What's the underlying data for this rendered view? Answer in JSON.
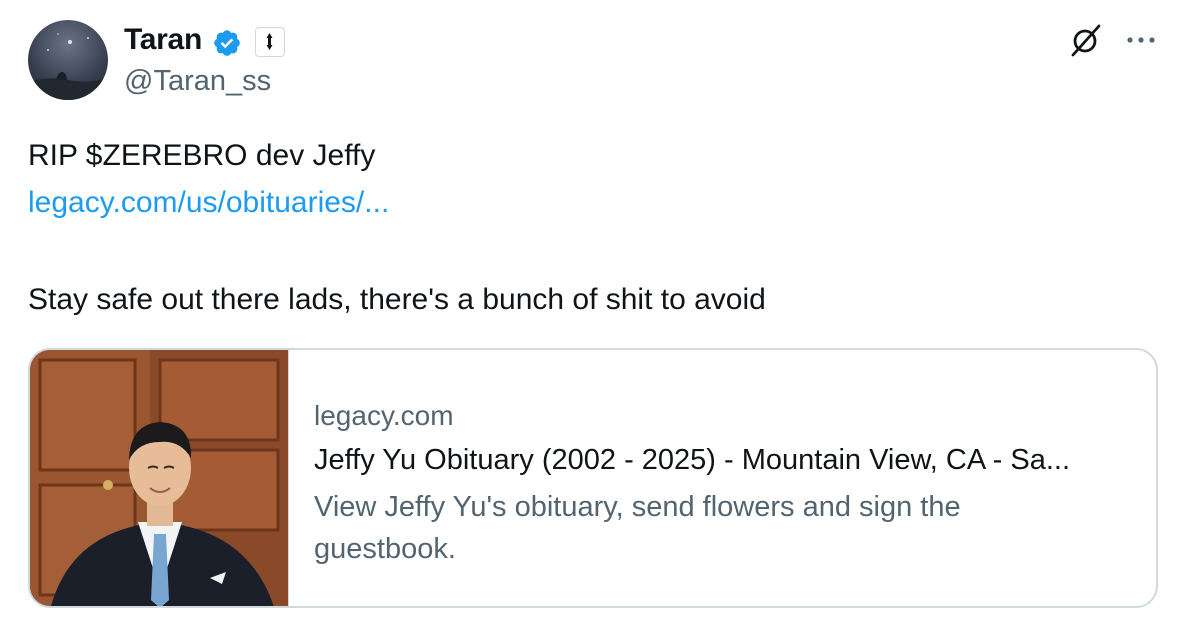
{
  "author": {
    "display_name": "Taran",
    "handle": "@Taran_ss",
    "verified": true,
    "avatar_icon": "avatar-night-sky",
    "affiliate_badge_icon": "affiliate-badge-icon"
  },
  "header_actions": {
    "grok_icon": "grok-icon",
    "more_icon": "more-icon"
  },
  "tweet": {
    "line1": "RIP $ZEREBRO dev Jeffy",
    "link_text": "legacy.com/us/obituaries/...",
    "line3": "Stay safe out there lads, there's a bunch of shit to avoid"
  },
  "link_card": {
    "domain": "legacy.com",
    "title": "Jeffy Yu Obituary (2002 - 2025) - Mountain View, CA - Sa...",
    "description": "View Jeffy Yu's obituary, send flowers and sign the guestbook."
  },
  "colors": {
    "link": "#1d9bf0",
    "secondary_text": "#536471",
    "verified": "#1d9bf0",
    "border": "#cfd9de"
  }
}
